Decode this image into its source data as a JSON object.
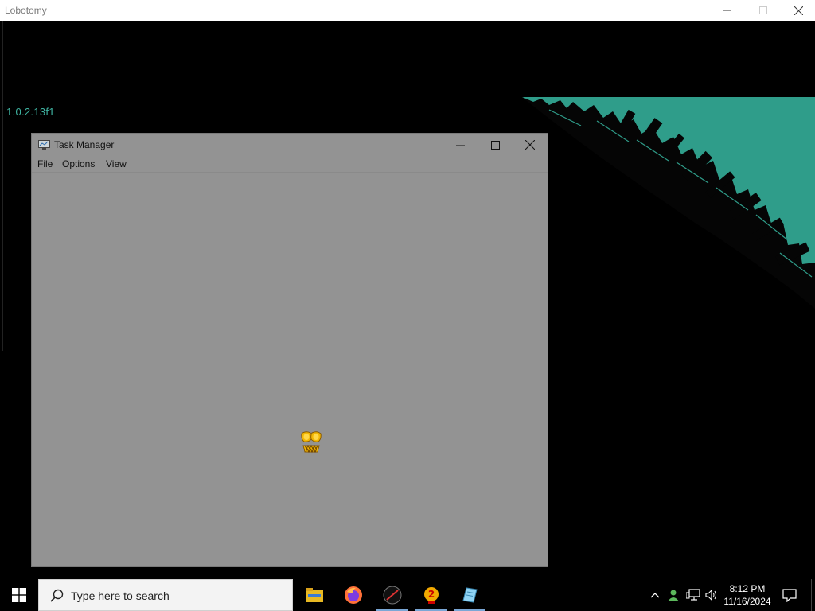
{
  "game_window": {
    "title": "Lobotomy",
    "version_text": "1.0.2.13f1"
  },
  "task_manager": {
    "title": "Task Manager",
    "menu": [
      "File",
      "Options",
      "View"
    ]
  },
  "taskbar": {
    "search_placeholder": "Type here to search",
    "apps": [
      "file-explorer-icon",
      "firefox-icon",
      "game-app-icon",
      "app-icon",
      "notepad-icon"
    ],
    "clock_time": "8:12 PM",
    "clock_date": "11/16/2024"
  },
  "colors": {
    "accent_teal": "#2f9d8a",
    "version_text": "#3fb4a2",
    "task_manager_bg": "#939393"
  }
}
